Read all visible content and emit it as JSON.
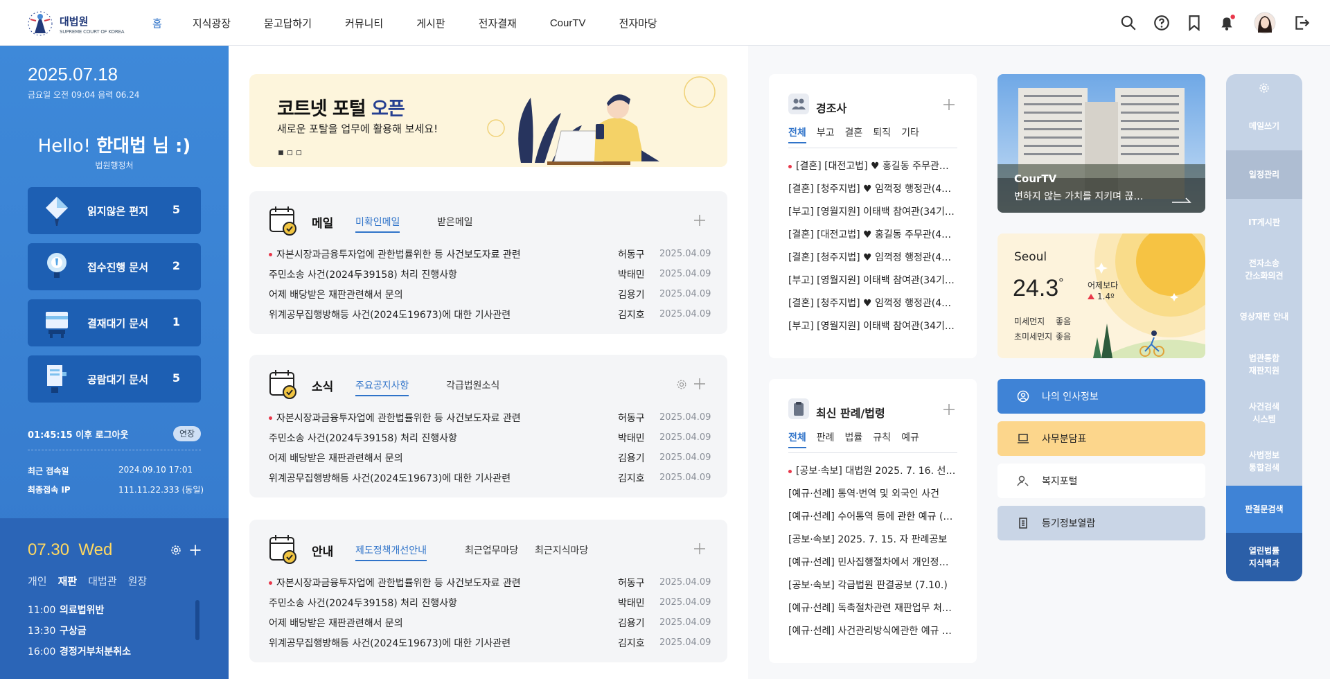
{
  "header": {
    "logo": {
      "title": "대법원",
      "subtitle": "SUPREME COURT OF KOREA"
    },
    "nav": [
      "홈",
      "지식광장",
      "묻고답하기",
      "커뮤니티",
      "게시판",
      "전자결재",
      "CourTV",
      "전자마당"
    ],
    "icons": [
      "search-icon",
      "help-icon",
      "bookmark-icon",
      "bell-icon",
      "avatar",
      "logout-icon"
    ]
  },
  "left": {
    "date": "2025.07.18",
    "sub": "금요일 오전 09:04  음력 06.24",
    "hello_pre": "Hello!",
    "hello_name": "한대법 님 :)",
    "org": "법원행정처",
    "cards": [
      {
        "label": "읽지않은 편지",
        "count": "5",
        "icon": "letter-icon"
      },
      {
        "label": "접수진행 문서",
        "count": "2",
        "icon": "bulb-icon"
      },
      {
        "label": "결재대기 문서",
        "count": "1",
        "icon": "document-icon"
      },
      {
        "label": "공람대기 문서",
        "count": "5",
        "icon": "clipboard-icon"
      }
    ],
    "logout": "01:45:15 이후 로그아웃",
    "extend": "연장",
    "last_login_label": "최근 접속일",
    "last_login": "2024.09.10 17:01",
    "last_ip_label": "최종접속 IP",
    "last_ip": "111.11.22.333 (동일)"
  },
  "schedule": {
    "date": "07.30",
    "day": "Wed",
    "tabs": [
      "개인",
      "재판",
      "대법관",
      "원장"
    ],
    "active_tab": "재판",
    "items": [
      {
        "time": "11:00",
        "title": "의료법위반"
      },
      {
        "time": "13:30",
        "title": "구상금"
      },
      {
        "time": "16:00",
        "title": "경정거부처분취소"
      }
    ]
  },
  "banner": {
    "title_pre": "코트넷 포털",
    "title_hl": "오픈",
    "subtitle": "새로운 포탈을 업무에 활용해 보세요!"
  },
  "boxes": [
    {
      "title": "메일",
      "tabs": [
        "미확인메일",
        "받은메일"
      ],
      "gear": false,
      "rows": [
        {
          "text": "자본시장과금융투자업에 관한법률위한 등 사건보도자료 관련",
          "author": "허동구",
          "date": "2025.04.09",
          "new": true
        },
        {
          "text": "주민소송 사건(2024두39158) 처리 진행사항",
          "author": "박태민",
          "date": "2025.04.09",
          "new": false
        },
        {
          "text": "어제 배당받은 재판관련해서 문의",
          "author": "김용기",
          "date": "2025.04.09",
          "new": false
        },
        {
          "text": "위계공무집행방해등 사건(2024도19673)에 대한 기사관련",
          "author": "김지호",
          "date": "2025.04.09",
          "new": false
        }
      ]
    },
    {
      "title": "소식",
      "tabs": [
        "주요공지사항",
        "각급법원소식"
      ],
      "gear": true,
      "rows": [
        {
          "text": "자본시장과금융투자업에 관한법률위한 등 사건보도자료 관련",
          "author": "허동구",
          "date": "2025.04.09",
          "new": true
        },
        {
          "text": "주민소송 사건(2024두39158) 처리 진행사항",
          "author": "박태민",
          "date": "2025.04.09",
          "new": false
        },
        {
          "text": "어제 배당받은 재판관련해서 문의",
          "author": "김용기",
          "date": "2025.04.09",
          "new": false
        },
        {
          "text": "위계공무집행방해등 사건(2024도19673)에 대한 기사관련",
          "author": "김지호",
          "date": "2025.04.09",
          "new": false
        }
      ]
    },
    {
      "title": "안내",
      "tabs": [
        "제도정책개선안내",
        "최근업무마당",
        "최근지식마당"
      ],
      "gear": false,
      "rows": [
        {
          "text": "자본시장과금융투자업에 관한법률위한 등 사건보도자료 관련",
          "author": "허동구",
          "date": "2025.04.09",
          "new": true
        },
        {
          "text": "주민소송 사건(2024두39158) 처리 진행사항",
          "author": "박태민",
          "date": "2025.04.09",
          "new": false
        },
        {
          "text": "어제 배당받은 재판관련해서 문의",
          "author": "김용기",
          "date": "2025.04.09",
          "new": false
        },
        {
          "text": "위계공무집행방해등 사건(2024도19673)에 대한 기사관련",
          "author": "김지호",
          "date": "2025.04.09",
          "new": false
        }
      ]
    }
  ],
  "events": {
    "title": "경조사",
    "tabs": [
      "전체",
      "부고",
      "결혼",
      "퇴직",
      "기타"
    ],
    "items": [
      "[결혼] [대전고법] ♥ 홍길동 주무관…",
      "[결혼] [청주지법] ♥ 임꺽정 행정관(4…",
      "[부고] [영월지원] 이태백 참여관(34기)…",
      "[결혼] [대전고법] ♥ 홍길동 주무관(4…",
      "[결혼] [청주지법] ♥ 임꺽정 행정관(4…",
      "[부고] [영월지원] 이태백 참여관(34기…",
      "[결혼] [청주지법] ♥ 임꺽정 행정관(4…",
      "[부고] [영월지원] 이태백 참여관(34기…"
    ]
  },
  "rulings": {
    "title": "최신 판례/법령",
    "tabs": [
      "전체",
      "판례",
      "법률",
      "규칙",
      "예규"
    ],
    "items": [
      "[공보·속보] 대법원 2025. 7. 16. 선고…",
      "[예규·선례] 통역·번역 및 외국인 사건",
      "[예규·선례] 수어통역 등에 관한 예규 (…",
      "[공보·속보] 2025. 7. 15. 자 판례공보",
      "[예규·선례] 민사집행절차에서 개인정…",
      "[공보·속보] 각급법원 판결공보 (7.10.)",
      "[예규·선례] 독촉절차관련 재판업무 처…",
      "[예규·선례] 사건관리방식에관한 예규 …"
    ]
  },
  "courtv": {
    "title": "CourTV",
    "subtitle": "변하지 않는 가치를 지키며 끊…"
  },
  "weather": {
    "city": "Seoul",
    "temp": "24.3",
    "deg": "°",
    "compare": "어제보다",
    "delta": "1.4º",
    "dust_label": "미세먼지",
    "dust": "좋음",
    "fine_label": "초미세먼지",
    "fine": "좋음"
  },
  "quick_buttons": [
    {
      "label": "나의 인사정보",
      "icon": "person-icon",
      "bg": "#3f83d6",
      "fg": "#ffffff"
    },
    {
      "label": "사무분담표",
      "icon": "laptop-icon",
      "bg": "#fcd68c",
      "fg": "#222222"
    },
    {
      "label": "복지포털",
      "icon": "user-search-icon",
      "bg": "#ffffff",
      "fg": "#222222"
    },
    {
      "label": "등기정보열람",
      "icon": "building-icon",
      "bg": "#c9d5e6",
      "fg": "#222222"
    }
  ],
  "quick_side": [
    {
      "label": "메일쓰기",
      "bg": "#c5d3e6"
    },
    {
      "label": "일정관리",
      "bg": "#aebdd2"
    },
    {
      "label": "IT게시판",
      "bg": "#c5d3e6"
    },
    {
      "label": "전자소송\n간소화의견",
      "bg": "#c5d3e6"
    },
    {
      "label": "영상재판 안내",
      "bg": "#c5d3e6"
    },
    {
      "label": "법관통합\n재판지원",
      "bg": "#c5d3e6"
    },
    {
      "label": "사건검색\n시스템",
      "bg": "#c5d3e6"
    },
    {
      "label": "사법정보\n통합검색",
      "bg": "#c5d3e6"
    },
    {
      "label": "판결문검색",
      "bg": "#3f83d6"
    },
    {
      "label": "열린법률\n지식백과",
      "bg": "#2b5fa8"
    }
  ]
}
